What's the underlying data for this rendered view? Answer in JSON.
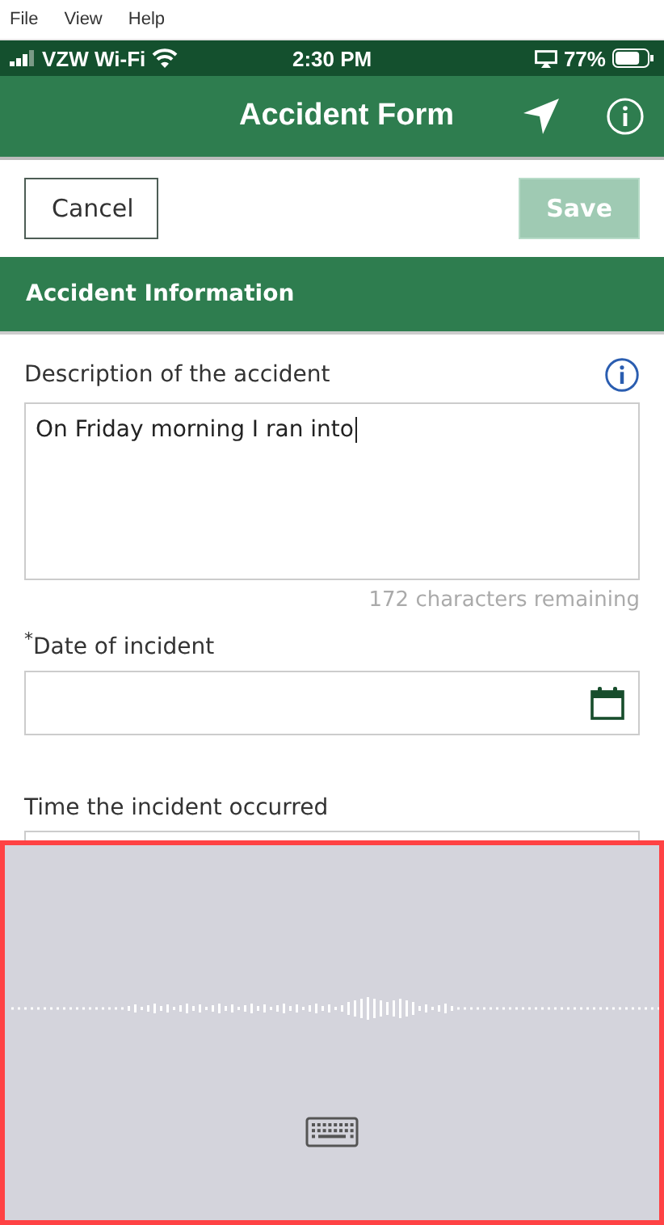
{
  "menu_bar": [
    "File",
    "View",
    "Help"
  ],
  "status_bar": {
    "carrier": "VZW Wi-Fi",
    "time": "2:30 PM",
    "battery": "77%"
  },
  "header": {
    "title": "Accident Form"
  },
  "actions": [
    {
      "label": "Cancel",
      "kind": "secondary",
      "disabled": false
    },
    {
      "label": "Save",
      "kind": "primary",
      "disabled": true
    }
  ],
  "section": {
    "title": "Accident Information"
  },
  "fields": [
    {
      "kind": "textarea",
      "label": "Description of the accident",
      "required": false,
      "value": "On Friday morning I ran into",
      "counter": "172 characters remaining"
    },
    {
      "kind": "date",
      "label": "Date of incident",
      "required": true,
      "required_mark": "*"
    },
    {
      "kind": "time",
      "label": "Time the incident occurred",
      "required": false
    }
  ],
  "dictation": {
    "kind": "listening",
    "highlighted": true
  }
}
